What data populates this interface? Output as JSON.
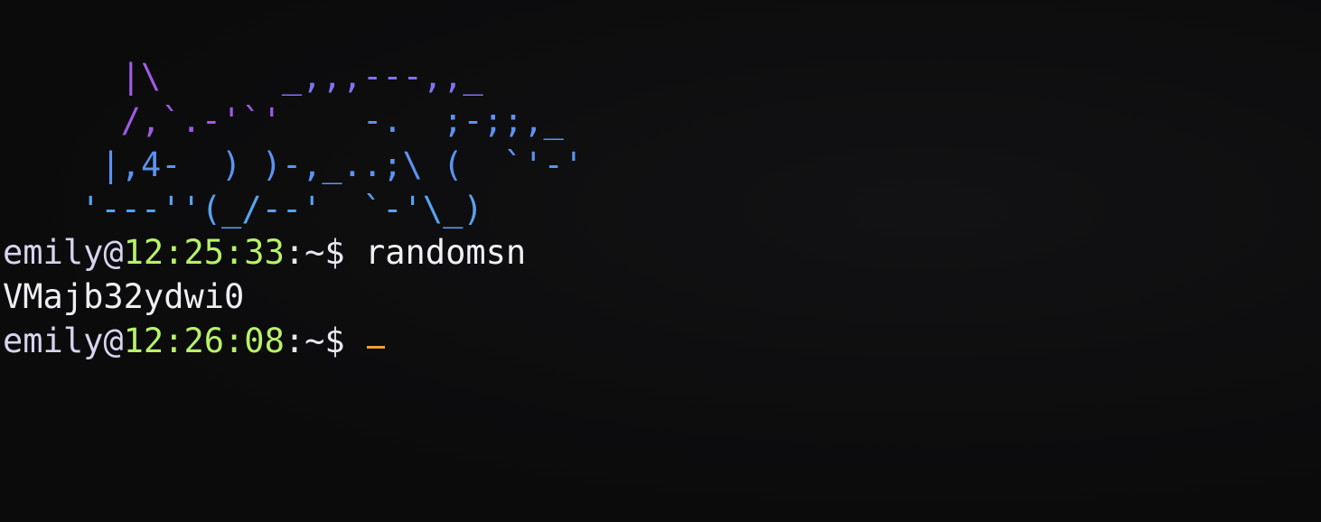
{
  "ascii_art": {
    "lines": [
      [
        "      ",
        "|\\",
        "      ",
        "_,,,---,,_"
      ],
      [
        "      ",
        "/,`.-'`'",
        "    ",
        "-.  ;-;;,_"
      ],
      [
        "     ",
        "|,4-  ) )-,_..;\\ (  `'-'"
      ],
      [
        "    ",
        "'---''(_/--'  `-'\\_)"
      ]
    ]
  },
  "session": [
    {
      "type": "prompt",
      "user": "emily@",
      "time": "12:25:33",
      "path": ":~$ ",
      "command": "randomsn"
    },
    {
      "type": "output",
      "text": "VMajb32ydwi0"
    },
    {
      "type": "prompt",
      "user": "emily@",
      "time": "12:26:08",
      "path": ":~$ ",
      "command": ""
    }
  ],
  "colors": {
    "background": "#0c0c0d",
    "user": "#d8d3ee",
    "time": "#b7f26a",
    "cursor": "#f0a03a",
    "art_gradient": [
      "#a05be6",
      "#7d74f2",
      "#5c93f2",
      "#58a3ef"
    ]
  }
}
